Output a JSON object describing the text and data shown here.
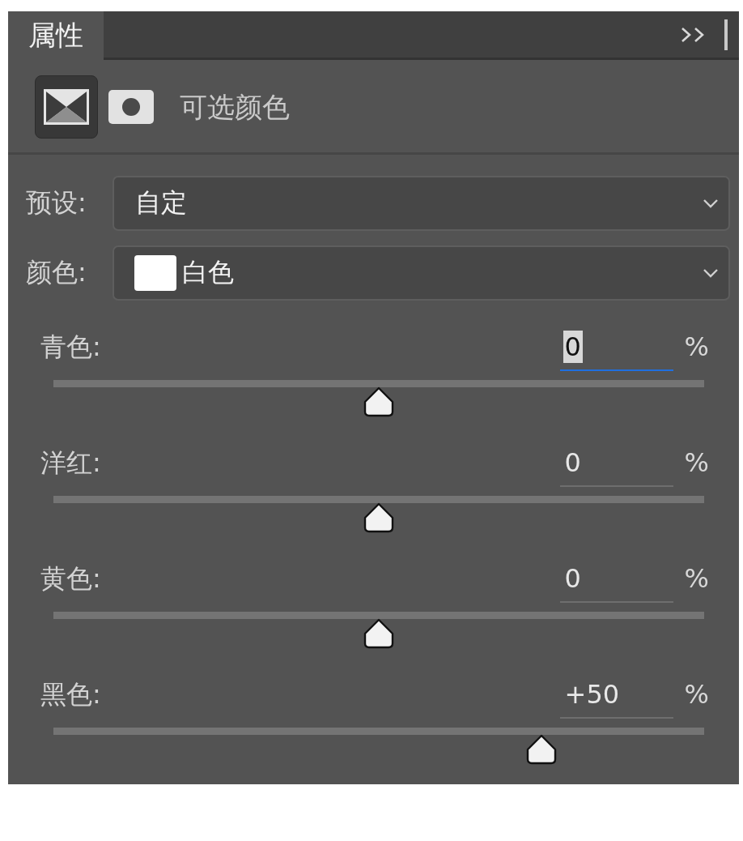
{
  "tab": {
    "label": "属性",
    "selected": true
  },
  "mode_buttons": [
    {
      "kind": "adjustment",
      "selected": true
    },
    {
      "kind": "mask",
      "selected": false
    }
  ],
  "title": "可选颜色",
  "preset": {
    "label": "预设:",
    "value": "自定"
  },
  "color": {
    "label": "颜色:",
    "value": "白色",
    "swatch": {
      "color": "#ffffff"
    }
  },
  "sliders": [
    {
      "label": "青色:",
      "value": "0",
      "unit": "%",
      "level": 0.5,
      "focused": true
    },
    {
      "label": "洋红:",
      "value": "0",
      "unit": "%",
      "level": 0.5,
      "focused": false
    },
    {
      "label": "黄色:",
      "value": "0",
      "unit": "%",
      "level": 0.5,
      "focused": false
    },
    {
      "label": "黑色:",
      "value": "+50",
      "unit": "%",
      "level": 0.75,
      "focused": false
    }
  ]
}
